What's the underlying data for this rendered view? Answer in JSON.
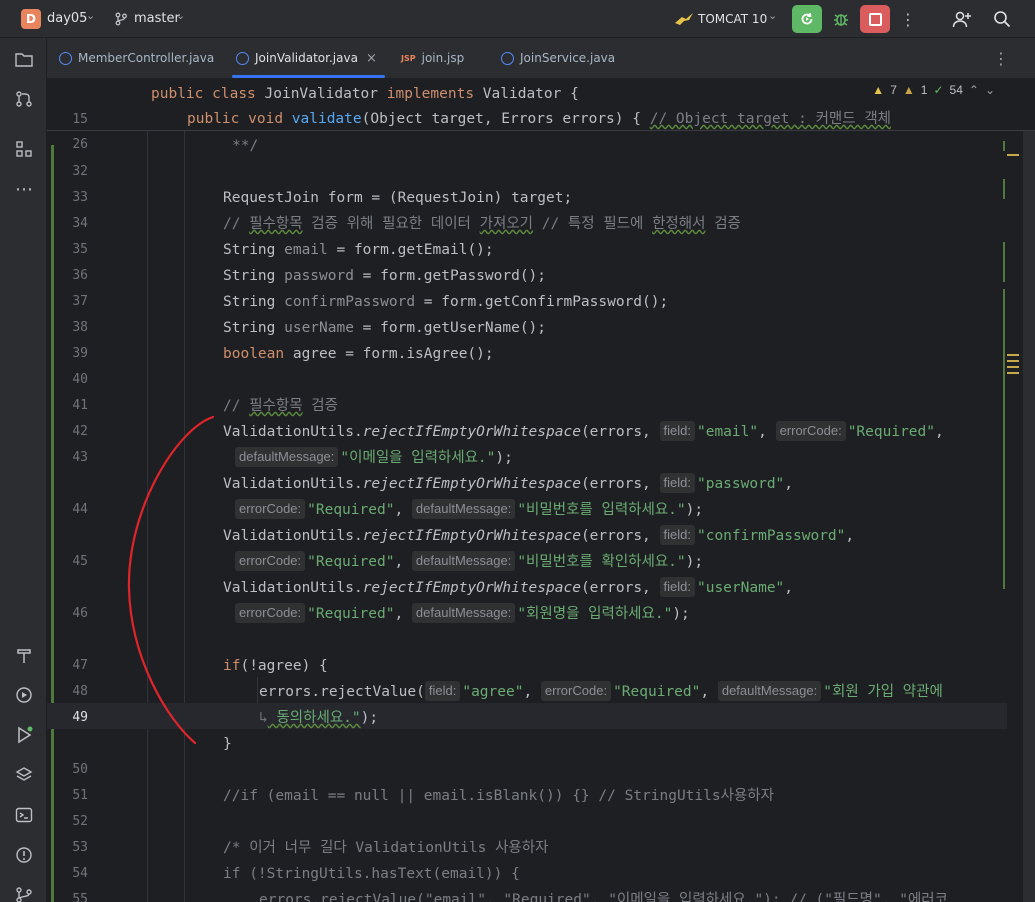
{
  "titlebar": {
    "project_badge": "D",
    "project_name": "day05",
    "branch": "master",
    "run_config": "TOMCAT 10",
    "colors": {
      "run_green": "#5fb865",
      "stop_red": "#db5c5c"
    }
  },
  "tabs": [
    {
      "label": "MemberController.java",
      "type": "java",
      "active": false
    },
    {
      "label": "JoinValidator.java",
      "type": "java",
      "active": true,
      "close": "×"
    },
    {
      "label": "join.jsp",
      "type": "jsp",
      "active": false,
      "icon_text": "JSP"
    },
    {
      "label": "JoinService.java",
      "type": "java",
      "active": false
    }
  ],
  "indicators": {
    "warnings": "7",
    "weak_warnings": "1",
    "typos": "54"
  },
  "lines": {
    "n15": "15",
    "n26": "26",
    "n32": "32",
    "n33": "33",
    "n34": "34",
    "n35": "35",
    "n36": "36",
    "n37": "37",
    "n38": "38",
    "n39": "39",
    "n40": "40",
    "n41": "41",
    "n42": "42",
    "n43": "43",
    "n44": "44",
    "n45": "45",
    "n46": "46",
    "n47": "47",
    "n48": "48",
    "n49": "49",
    "n50": "50",
    "n51": "51",
    "n52": "52",
    "n53": "53",
    "n54": "54",
    "n55": "55"
  },
  "code": {
    "l15_pub": "public",
    "l15_class": "class",
    "l15_name": "JoinValidator",
    "l15_impl": "implements",
    "l15_iface": "Validator {",
    "l26_pub": "public",
    "l26_void": "void",
    "l26_fn": "validate",
    "l26_args": "(Object target, Errors errors) { ",
    "l26_cm": "// Object target : 커맨드 객체",
    "l32": "**/",
    "l34": "RequestJoin form = (RequestJoin) target;",
    "l35_a": "// ",
    "l35_b": "필수항목",
    "l35_c": " 검증 위해 필요한 데이터 ",
    "l35_d": "가져오기",
    "l35_e": " // 특정 필드에 ",
    "l35_f": "한정해서",
    "l35_g": " 검증",
    "l36_t": "String ",
    "l36_v": "email",
    "l36_r": " = form.getEmail();",
    "l37_t": "String ",
    "l37_v": "password",
    "l37_r": " = form.getPassword();",
    "l38_t": "String ",
    "l38_v": "confirmPassword",
    "l38_r": " = form.getConfirmPassword();",
    "l39_t": "String ",
    "l39_v": "userName",
    "l39_r": " = form.getUserName();",
    "l40_k": "boolean",
    "l40_r": " agree = form.isAgree();",
    "l42_a": "// ",
    "l42_b": "필수항목",
    "l42_c": " 검증",
    "util": "ValidationUtils.",
    "method": "rejectIfEmptyOrWhitespace",
    "errs": "(errors, ",
    "hint_field": "field:",
    "hint_code": "errorCode:",
    "hint_msg": "defaultMessage:",
    "v_email": "\"email\"",
    "v_password": "\"password\"",
    "v_confirm": "\"confirmPassword\"",
    "v_username": "\"userName\"",
    "v_required": "\"Required\"",
    "m_email": "\"이메일을 입력하세요.\"",
    "m_password": "\"비밀번호를 입력하세요.\"",
    "m_confirm": "\"비밀번호를 확인하세요.\"",
    "m_username": "\"회원명을 입력하세요.\"",
    "comma": ", ",
    "end": ");",
    "l48_k": "if",
    "l48_r": "(!agree) {",
    "l49_a": "errors.rejectValue(",
    "v_agree": "\"agree\"",
    "m_agree1": "\"회원 가입 약관에",
    "m_agree2": " 동의하세요.\"",
    "l49_end": ");",
    "l50": "}",
    "l52": "//if (email == null || email.isBlank()) {} // StringUtils사용하자",
    "l54": "/* 이거 너무 길다 ValidationUtils 사용하자",
    "l55_k": "if",
    "l55_r": " (!StringUtils.hasText(email)) {",
    "l56": "errors.rejectValue(\"email\", \"Required\", \"이메일을 입력하세요.\"); // (\"필드명\", \"에러코"
  }
}
